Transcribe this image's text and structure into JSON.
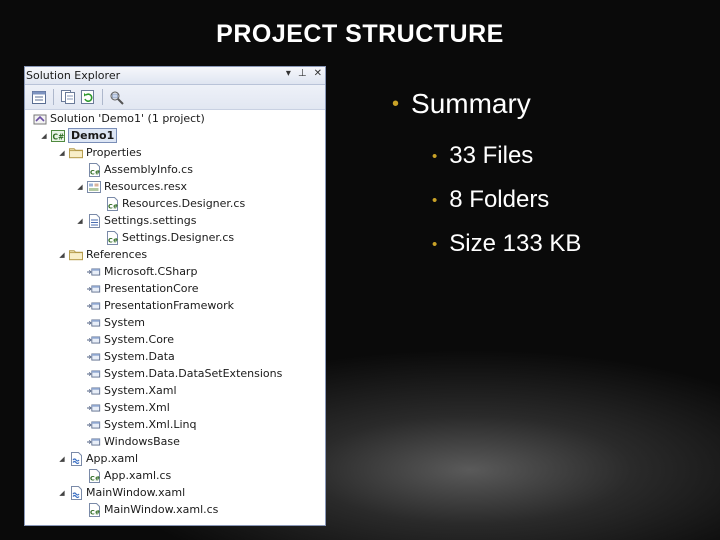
{
  "slide": {
    "title": "PROJECT STRUCTURE"
  },
  "solution_explorer": {
    "title": "Solution Explorer",
    "controls": [
      "▾",
      "⊥",
      "✕"
    ],
    "toolbar_icons": [
      "properties-icon",
      "show-all-files-icon",
      "refresh-icon",
      "view-class-diagram-icon"
    ],
    "items": [
      {
        "label": "Solution 'Demo1' (1 project)",
        "depth": 0,
        "icon": "solution-icon",
        "expander": ""
      },
      {
        "label": "Demo1",
        "depth": 1,
        "icon": "csharp-project-icon",
        "expander": "◢",
        "selected": true
      },
      {
        "label": "Properties",
        "depth": 2,
        "icon": "folder-icon",
        "expander": "◢"
      },
      {
        "label": "AssemblyInfo.cs",
        "depth": 3,
        "icon": "cs-file-icon",
        "expander": ""
      },
      {
        "label": "Resources.resx",
        "depth": 3,
        "icon": "resx-file-icon",
        "expander": "◢"
      },
      {
        "label": "Resources.Designer.cs",
        "depth": 4,
        "icon": "cs-file-icon",
        "expander": ""
      },
      {
        "label": "Settings.settings",
        "depth": 3,
        "icon": "settings-file-icon",
        "expander": "◢"
      },
      {
        "label": "Settings.Designer.cs",
        "depth": 4,
        "icon": "cs-file-icon",
        "expander": ""
      },
      {
        "label": "References",
        "depth": 2,
        "icon": "folder-icon",
        "expander": "◢"
      },
      {
        "label": "Microsoft.CSharp",
        "depth": 3,
        "icon": "reference-icon",
        "expander": ""
      },
      {
        "label": "PresentationCore",
        "depth": 3,
        "icon": "reference-icon",
        "expander": ""
      },
      {
        "label": "PresentationFramework",
        "depth": 3,
        "icon": "reference-icon",
        "expander": ""
      },
      {
        "label": "System",
        "depth": 3,
        "icon": "reference-icon",
        "expander": ""
      },
      {
        "label": "System.Core",
        "depth": 3,
        "icon": "reference-icon",
        "expander": ""
      },
      {
        "label": "System.Data",
        "depth": 3,
        "icon": "reference-icon",
        "expander": ""
      },
      {
        "label": "System.Data.DataSetExtensions",
        "depth": 3,
        "icon": "reference-icon",
        "expander": ""
      },
      {
        "label": "System.Xaml",
        "depth": 3,
        "icon": "reference-icon",
        "expander": ""
      },
      {
        "label": "System.Xml",
        "depth": 3,
        "icon": "reference-icon",
        "expander": ""
      },
      {
        "label": "System.Xml.Linq",
        "depth": 3,
        "icon": "reference-icon",
        "expander": ""
      },
      {
        "label": "WindowsBase",
        "depth": 3,
        "icon": "reference-icon",
        "expander": ""
      },
      {
        "label": "App.xaml",
        "depth": 2,
        "icon": "xaml-file-icon",
        "expander": "◢"
      },
      {
        "label": "App.xaml.cs",
        "depth": 3,
        "icon": "cs-file-icon",
        "expander": ""
      },
      {
        "label": "MainWindow.xaml",
        "depth": 2,
        "icon": "xaml-file-icon",
        "expander": "◢"
      },
      {
        "label": "MainWindow.xaml.cs",
        "depth": 3,
        "icon": "cs-file-icon",
        "expander": ""
      }
    ]
  },
  "summary": {
    "heading": "Summary",
    "items": [
      "33 Files",
      "8 Folders",
      "Size 133 KB"
    ]
  },
  "colors": {
    "bullet": "#c9a227",
    "text": "#ffffff",
    "background": "#000000"
  }
}
